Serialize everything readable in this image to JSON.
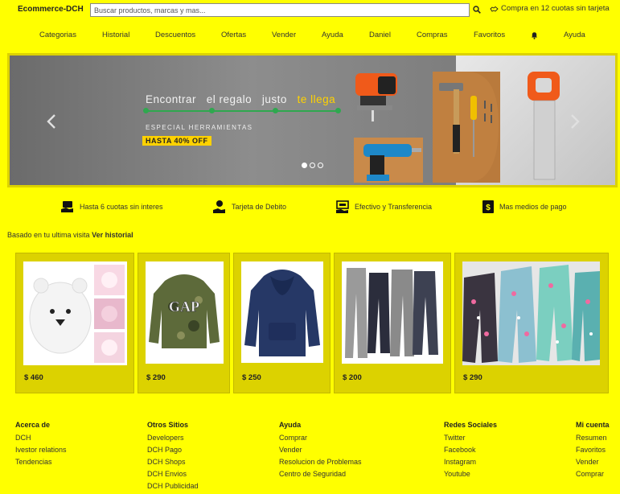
{
  "header": {
    "brand": "Ecommerce-DCH",
    "search_placeholder": "Buscar productos, marcas y mas...",
    "promo": "Compra en 12 cuotas sin tarjeta"
  },
  "nav": [
    "Categorias",
    "Historial",
    "Descuentos",
    "Ofertas",
    "Vender",
    "Ayuda",
    "Daniel",
    "Compras",
    "Favoritos",
    "Ayuda"
  ],
  "hero": {
    "words": [
      "Encontrar",
      "el regalo",
      "justo"
    ],
    "highlight": "te llega",
    "subtitle": "ESPECIAL HERRAMIENTAS",
    "badge": "HASTA 40% OFF",
    "colors": {
      "accent": "#ffd200",
      "line": "#2fa84f"
    }
  },
  "features": [
    "Hasta 6 cuotas sin interes",
    "Tarjeta de Debito",
    "Efectivo y Transferencia",
    "Mas medios de pago"
  ],
  "recommendation": {
    "prefix": "Basado en tu ultima visita",
    "link": "Ver historial"
  },
  "products": [
    {
      "price": "$ 460",
      "image": "white-bear-hoodie"
    },
    {
      "price": "$ 290",
      "image": "camo-gap-hoodie"
    },
    {
      "price": "$ 250",
      "image": "navy-hoodie"
    },
    {
      "price": "$ 200",
      "image": "jogger-pants"
    },
    {
      "price": "$ 290",
      "image": "printed-pajama-pants"
    }
  ],
  "footer": [
    {
      "title": "Acerca de",
      "links": [
        "DCH",
        "Ivestor relations",
        "Tendencias"
      ]
    },
    {
      "title": "Otros Sitios",
      "links": [
        "Developers",
        "DCH Pago",
        "DCH Shops",
        "DCH Envios",
        "DCH Publicidad"
      ]
    },
    {
      "title": "Ayuda",
      "links": [
        "Comprar",
        "Vender",
        "Resolucion de Problemas",
        "Centro de Seguridad"
      ]
    },
    {
      "title": "Redes Sociales",
      "links": [
        "Twitter",
        "Facebook",
        "Instagram",
        "Youtube"
      ]
    },
    {
      "title": "Mi cuenta",
      "links": [
        "Resumen",
        "Favoritos",
        "Vender",
        "Comprar"
      ]
    }
  ],
  "colors": {
    "background": "#ffff00",
    "card": "#dcd200"
  }
}
